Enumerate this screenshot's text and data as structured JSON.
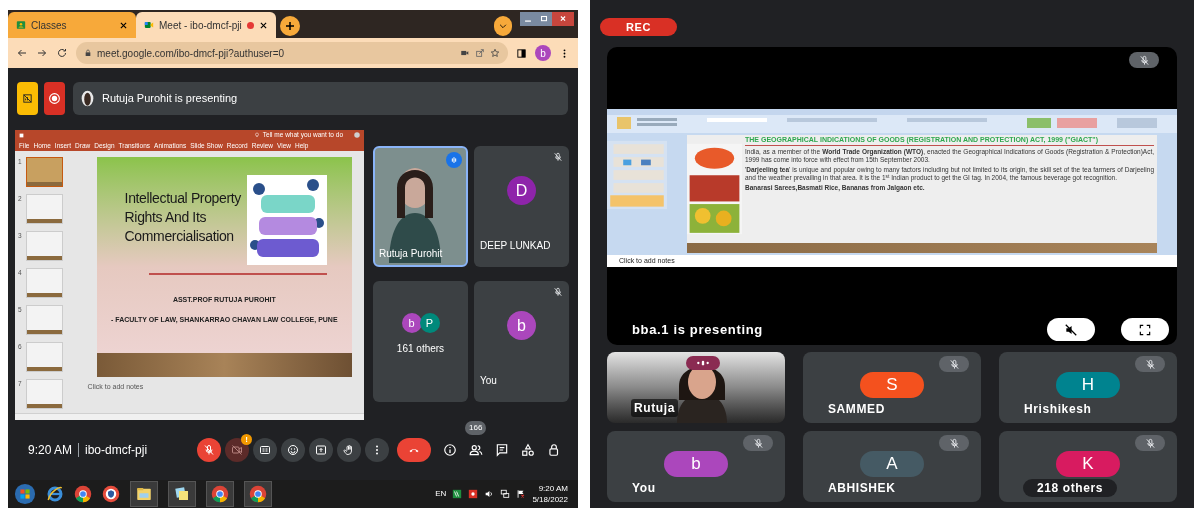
{
  "left_screen": {
    "browser_tabs": [
      {
        "title": "Classes",
        "selected": false,
        "recording": false
      },
      {
        "title": "Meet - ibo-dmcf-pji",
        "selected": true,
        "recording": true
      }
    ],
    "address_bar": {
      "url": "meet.google.com/ibo-dmcf-pji?authuser=0"
    },
    "profile_initial": "b",
    "presenting_banner": "Rutuja Purohit is presenting",
    "shared_window": {
      "ribbon_tabs": [
        "File",
        "Home",
        "Insert",
        "Draw",
        "Design",
        "Transitions",
        "Animations",
        "Slide Show",
        "Record",
        "Review",
        "View",
        "Help"
      ],
      "tell_me": "Tell me what you want to do",
      "thumbnails": [
        {
          "number": "1",
          "selected": true
        },
        {
          "number": "2",
          "selected": false
        },
        {
          "number": "3",
          "selected": false
        },
        {
          "number": "4",
          "selected": false
        },
        {
          "number": "5",
          "selected": false
        },
        {
          "number": "6",
          "selected": false
        },
        {
          "number": "7",
          "selected": false
        }
      ],
      "slide": {
        "title_lines": [
          "Intellectual Property",
          "Rights And Its",
          "Commercialisation"
        ],
        "author": "ASST.PROF RUTUJA PUROHIT",
        "affiliation": "- FACULTY OF LAW, SHANKARRAO CHAVAN LAW COLLEGE, PUNE"
      },
      "notes_placeholder": "Click to add notes"
    },
    "participants": [
      {
        "kind": "video",
        "name": "Rutuja Purohit",
        "speaking": true,
        "muted": false
      },
      {
        "kind": "avatar",
        "name": "DEEP LUNKAD",
        "initial": "D",
        "color": "#8e24aa",
        "speaking": false,
        "muted": true
      },
      {
        "kind": "others",
        "name": "161 others",
        "avatars": [
          {
            "initial": "b",
            "color": "#ab47bc"
          },
          {
            "initial": "P",
            "color": "#00897b"
          }
        ]
      },
      {
        "kind": "avatar",
        "name": "You",
        "initial": "b",
        "color": "#ab47bc",
        "speaking": false,
        "muted": true
      }
    ],
    "meeting_time": "9:20 AM",
    "meeting_code": "ibo-dmcf-pji",
    "controls": [
      {
        "kind": "mic",
        "on": false
      },
      {
        "kind": "camera",
        "on": false,
        "alert": "!"
      },
      {
        "kind": "captions",
        "on": false
      },
      {
        "kind": "reactions",
        "on": false
      },
      {
        "kind": "present",
        "on": false
      },
      {
        "kind": "hand",
        "on": false
      },
      {
        "kind": "more"
      },
      {
        "kind": "leave"
      }
    ],
    "people_count": "166",
    "taskbar": {
      "language": "EN",
      "time": "9:20 AM",
      "date": "5/18/2022"
    }
  },
  "right_screen": {
    "rec_badge": "REC",
    "shared_slide": {
      "title": "THE GEOGRAPHICAL INDICATIONS OF GOODS (REGISTRATION AND PROTECTION) ACT, 1999 (\"GIACT\")",
      "paragraphs": [
        "India, as a member of the **World Trade Organization (WTO)**, enacted the Geographical Indications of Goods (Registration & Protection)Act, 1999 has come into force with effect from 15th September 2003.",
        "'**Darjeeling tea**' is unique and popular owing to many factors including but not limited to its origin, the skill set of the tea farmers of Darjeeling and the weather prevailing in that area. It is the 1$^{st}$ Indian product to get the GI tag. In 2004, the famous beverage got recognition.",
        "**Banarasi Sarees,Basmati Rice, Bananas from Jalgaon etc.**"
      ],
      "notes_placeholder": "Click to add notes"
    },
    "presenter_label": "bba.1 is presenting",
    "tiles": [
      {
        "kind": "video",
        "name": "Rutuja",
        "speaking": true,
        "muted": false
      },
      {
        "kind": "avatar",
        "name": "SAMMED",
        "initial": "S",
        "color": "#f4511e",
        "speaking": false,
        "muted": true
      },
      {
        "kind": "avatar",
        "name": "Hrishikesh",
        "initial": "H",
        "color": "#00838f",
        "speaking": false,
        "muted": true
      },
      {
        "kind": "avatar",
        "name": "You",
        "initial": "b",
        "color": "#ab47bc",
        "speaking": false,
        "muted": true
      },
      {
        "kind": "avatar",
        "name": "ABHISHEK",
        "initial": "A",
        "color": "#455a64",
        "speaking": false,
        "muted": true
      },
      {
        "kind": "others",
        "name": "218 others",
        "initial": "K",
        "color": "#d81b60",
        "speaking": false,
        "muted": true
      }
    ]
  }
}
